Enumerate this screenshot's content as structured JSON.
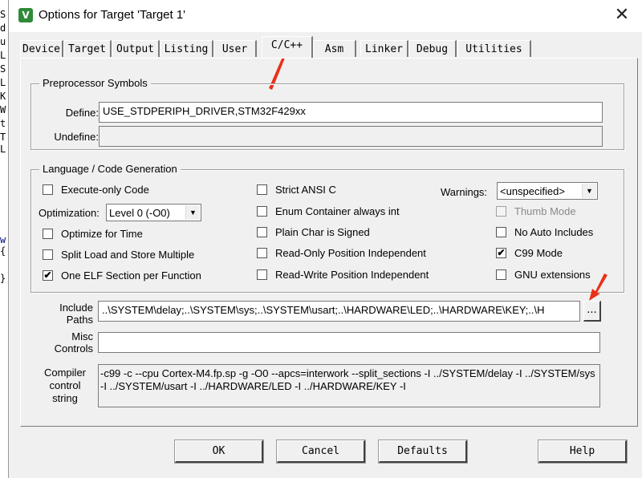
{
  "window": {
    "title": "Options for Target 'Target 1'",
    "app_icon_glyph": "V",
    "close_glyph": "✕"
  },
  "tabs": [
    {
      "label": "Device",
      "active": false
    },
    {
      "label": "Target",
      "active": false
    },
    {
      "label": "Output",
      "active": false
    },
    {
      "label": "Listing",
      "active": false
    },
    {
      "label": "User",
      "active": false
    },
    {
      "label": "C/C++",
      "active": true
    },
    {
      "label": "Asm",
      "active": false
    },
    {
      "label": "Linker",
      "active": false
    },
    {
      "label": "Debug",
      "active": false
    },
    {
      "label": "Utilities",
      "active": false
    }
  ],
  "preprocessor": {
    "title": "Preprocessor Symbols",
    "define_label": "Define:",
    "define_value": "USE_STDPERIPH_DRIVER,STM32F429xx",
    "undefine_label": "Undefine:",
    "undefine_value": ""
  },
  "codegen": {
    "title": "Language / Code Generation",
    "execute_only": {
      "label": "Execute-only Code",
      "checked": false
    },
    "optimization_label": "Optimization:",
    "optimization_value": "Level 0 (-O0)",
    "optimize_time": {
      "label": "Optimize for Time",
      "checked": false
    },
    "split_load": {
      "label": "Split Load and Store Multiple",
      "checked": false
    },
    "one_elf": {
      "label": "One ELF Section per Function",
      "checked": true
    },
    "strict_ansi": {
      "label": "Strict ANSI C",
      "checked": false
    },
    "enum_container": {
      "label": "Enum Container always int",
      "checked": false
    },
    "plain_char": {
      "label": "Plain Char is Signed",
      "checked": false
    },
    "read_only_pi": {
      "label": "Read-Only Position Independent",
      "checked": false
    },
    "read_write_pi": {
      "label": "Read-Write Position Independent",
      "checked": false
    },
    "warnings_label": "Warnings:",
    "warnings_value": "<unspecified>",
    "thumb_mode": {
      "label": "Thumb Mode",
      "checked": false,
      "disabled": true
    },
    "no_auto_includes": {
      "label": "No Auto Includes",
      "checked": false
    },
    "c99_mode": {
      "label": "C99 Mode",
      "checked": true
    },
    "gnu_extensions": {
      "label": "GNU extensions",
      "checked": false
    }
  },
  "paths": {
    "include_label_1": "Include",
    "include_label_2": "Paths",
    "include_value": "..\\SYSTEM\\delay;..\\SYSTEM\\sys;..\\SYSTEM\\usart;..\\HARDWARE\\LED;..\\HARDWARE\\KEY;..\\H",
    "browse_label": "...",
    "misc_label_1": "Misc",
    "misc_label_2": "Controls",
    "misc_value": "",
    "compiler_label_1": "Compiler",
    "compiler_label_2": "control",
    "compiler_label_3": "string",
    "compiler_value": "-c99 -c --cpu Cortex-M4.fp.sp -g -O0 --apcs=interwork --split_sections -I ../SYSTEM/delay -I ../SYSTEM/sys -I ../SYSTEM/usart -I ../HARDWARE/LED -I ../HARDWARE/KEY -I"
  },
  "buttons": {
    "ok": "OK",
    "cancel": "Cancel",
    "defaults": "Defaults",
    "help": "Help"
  },
  "check_glyph": "✔",
  "background_editor_glyphs": [
    "S",
    "d",
    "u",
    "L",
    "S",
    "L",
    "K",
    "W",
    "t",
    "T",
    "L",
    "w",
    "{",
    "}"
  ],
  "annotation_color": "#e8311a"
}
